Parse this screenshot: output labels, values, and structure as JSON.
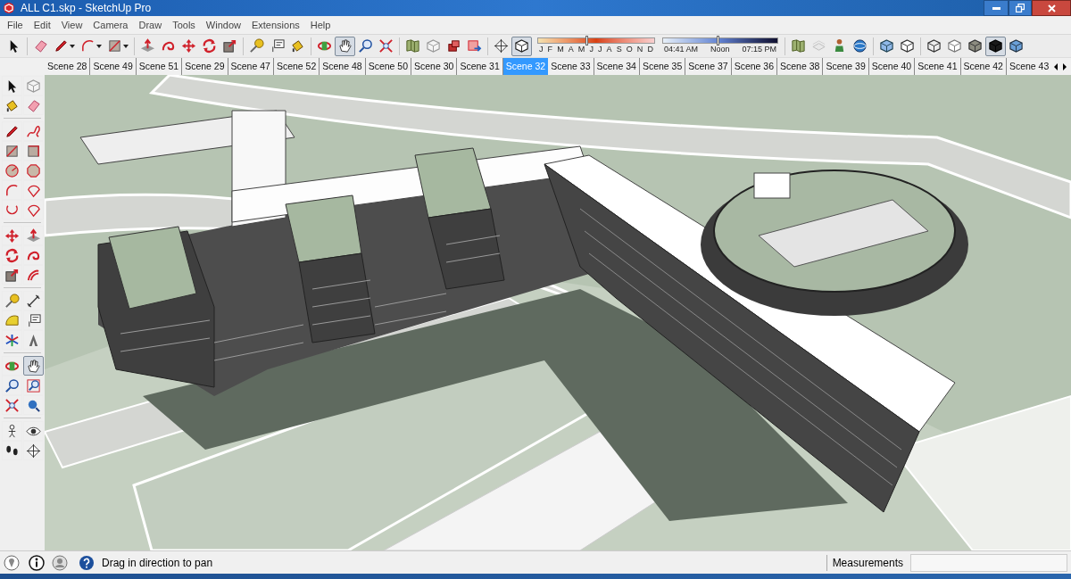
{
  "window": {
    "title": "ALL C1.skp - SketchUp Pro"
  },
  "menu": [
    "File",
    "Edit",
    "View",
    "Camera",
    "Draw",
    "Tools",
    "Window",
    "Extensions",
    "Help"
  ],
  "toolbar": [
    [
      {
        "kind": "select",
        "selected": false,
        "dropdown": false
      }
    ],
    [
      {
        "kind": "eraser",
        "selected": false,
        "dropdown": false
      },
      {
        "kind": "pencil",
        "selected": false,
        "dropdown": true
      },
      {
        "kind": "arc",
        "selected": false,
        "dropdown": true
      },
      {
        "kind": "rectangle",
        "selected": false,
        "dropdown": true
      }
    ],
    [
      {
        "kind": "pushpull",
        "selected": false,
        "dropdown": false
      },
      {
        "kind": "followme",
        "selected": false,
        "dropdown": false
      },
      {
        "kind": "move",
        "selected": false,
        "dropdown": false
      },
      {
        "kind": "rotate",
        "selected": false,
        "dropdown": false
      },
      {
        "kind": "scale",
        "selected": false,
        "dropdown": false
      }
    ],
    [
      {
        "kind": "tape",
        "selected": false,
        "dropdown": false
      },
      {
        "kind": "text",
        "selected": false,
        "dropdown": false
      },
      {
        "kind": "paint",
        "selected": false,
        "dropdown": false
      }
    ],
    [
      {
        "kind": "orbit",
        "selected": false,
        "dropdown": false
      },
      {
        "kind": "pan",
        "selected": true,
        "dropdown": false
      },
      {
        "kind": "zoom",
        "selected": false,
        "dropdown": false
      },
      {
        "kind": "extents",
        "selected": false,
        "dropdown": false
      }
    ],
    [
      {
        "kind": "map",
        "selected": false,
        "dropdown": false
      },
      {
        "kind": "components",
        "selected": false,
        "dropdown": false
      },
      {
        "kind": "warehouse",
        "selected": false,
        "dropdown": false
      },
      {
        "kind": "share",
        "selected": false,
        "dropdown": false
      }
    ],
    [
      {
        "kind": "section",
        "selected": false,
        "dropdown": false
      },
      {
        "kind": "shadows",
        "selected": true,
        "dropdown": false
      }
    ]
  ],
  "shadow_settings": {
    "months": {
      "labels": [
        "J",
        "F",
        "M",
        "A",
        "M",
        "J",
        "J",
        "A",
        "S",
        "O",
        "N",
        "D"
      ],
      "level": 0.41
    },
    "time": {
      "labels": [
        "04:41 AM",
        "Noon",
        "07:15 PM"
      ],
      "level": 0.47
    }
  },
  "toolbar_right": [
    [
      {
        "kind": "map",
        "selected": false
      },
      {
        "kind": "ghost",
        "selected": false
      },
      {
        "kind": "person",
        "selected": false
      },
      {
        "kind": "globe",
        "selected": false
      }
    ],
    [
      {
        "kind": "iso",
        "selected": false
      },
      {
        "kind": "top",
        "selected": false
      }
    ],
    [
      {
        "kind": "wireframe",
        "selected": false
      },
      {
        "kind": "hiddenline",
        "selected": false
      },
      {
        "kind": "shaded",
        "selected": false
      },
      {
        "kind": "textured",
        "selected": true
      },
      {
        "kind": "monochrome",
        "selected": false
      }
    ]
  ],
  "scenes": [
    {
      "label": "Scene 28",
      "selected": false
    },
    {
      "label": "Scene 49",
      "selected": false
    },
    {
      "label": "Scene 51",
      "selected": false
    },
    {
      "label": "Scene 29",
      "selected": false
    },
    {
      "label": "Scene 47",
      "selected": false
    },
    {
      "label": "Scene 52",
      "selected": false
    },
    {
      "label": "Scene 48",
      "selected": false
    },
    {
      "label": "Scene 50",
      "selected": false
    },
    {
      "label": "Scene 30",
      "selected": false
    },
    {
      "label": "Scene 31",
      "selected": false
    },
    {
      "label": "Scene 32",
      "selected": true
    },
    {
      "label": "Scene 33",
      "selected": false
    },
    {
      "label": "Scene 34",
      "selected": false
    },
    {
      "label": "Scene 35",
      "selected": false
    },
    {
      "label": "Scene 37",
      "selected": false
    },
    {
      "label": "Scene 36",
      "selected": false
    },
    {
      "label": "Scene 38",
      "selected": false
    },
    {
      "label": "Scene 39",
      "selected": false
    },
    {
      "label": "Scene 40",
      "selected": false
    },
    {
      "label": "Scene 41",
      "selected": false
    },
    {
      "label": "Scene 42",
      "selected": false
    },
    {
      "label": "Scene 43",
      "selected": false
    }
  ],
  "left_toolbar": [
    [
      [
        {
          "kind": "select",
          "selected": false
        },
        {
          "kind": "components",
          "selected": false
        }
      ],
      [
        {
          "kind": "paint",
          "selected": false
        },
        {
          "kind": "eraser",
          "selected": false
        }
      ]
    ],
    [
      [
        {
          "kind": "pencil",
          "selected": false
        },
        {
          "kind": "freehand",
          "selected": false
        }
      ],
      [
        {
          "kind": "rectangle",
          "selected": false
        },
        {
          "kind": "rotatedrect",
          "selected": false
        }
      ],
      [
        {
          "kind": "circle",
          "selected": false
        },
        {
          "kind": "polygon",
          "selected": false
        }
      ],
      [
        {
          "kind": "arc",
          "selected": false
        },
        {
          "kind": "pie",
          "selected": false
        }
      ],
      [
        {
          "kind": "twopointarc",
          "selected": false
        },
        {
          "kind": "pie",
          "selected": false
        }
      ]
    ],
    [
      [
        {
          "kind": "move",
          "selected": false
        },
        {
          "kind": "pushpull",
          "selected": false
        }
      ],
      [
        {
          "kind": "rotate",
          "selected": false
        },
        {
          "kind": "followme",
          "selected": false
        }
      ],
      [
        {
          "kind": "scale",
          "selected": false
        },
        {
          "kind": "offset",
          "selected": false
        }
      ]
    ],
    [
      [
        {
          "kind": "tape",
          "selected": false
        },
        {
          "kind": "dimension",
          "selected": false
        }
      ],
      [
        {
          "kind": "protractor",
          "selected": false
        },
        {
          "kind": "text",
          "selected": false
        }
      ],
      [
        {
          "kind": "axes",
          "selected": false
        },
        {
          "kind": "solidtext",
          "selected": false
        }
      ]
    ],
    [
      [
        {
          "kind": "orbit",
          "selected": false
        },
        {
          "kind": "pan",
          "selected": true
        }
      ],
      [
        {
          "kind": "zoom",
          "selected": false
        },
        {
          "kind": "zoomwindow",
          "selected": false
        }
      ],
      [
        {
          "kind": "extents",
          "selected": false
        },
        {
          "kind": "previous",
          "selected": false
        }
      ]
    ],
    [
      [
        {
          "kind": "camera",
          "selected": false
        },
        {
          "kind": "lookaround",
          "selected": false
        }
      ],
      [
        {
          "kind": "walk",
          "selected": false
        },
        {
          "kind": "section",
          "selected": false
        }
      ]
    ]
  ],
  "status_bar": {
    "message": "Drag in direction to pan",
    "measurements_label": "Measurements"
  }
}
